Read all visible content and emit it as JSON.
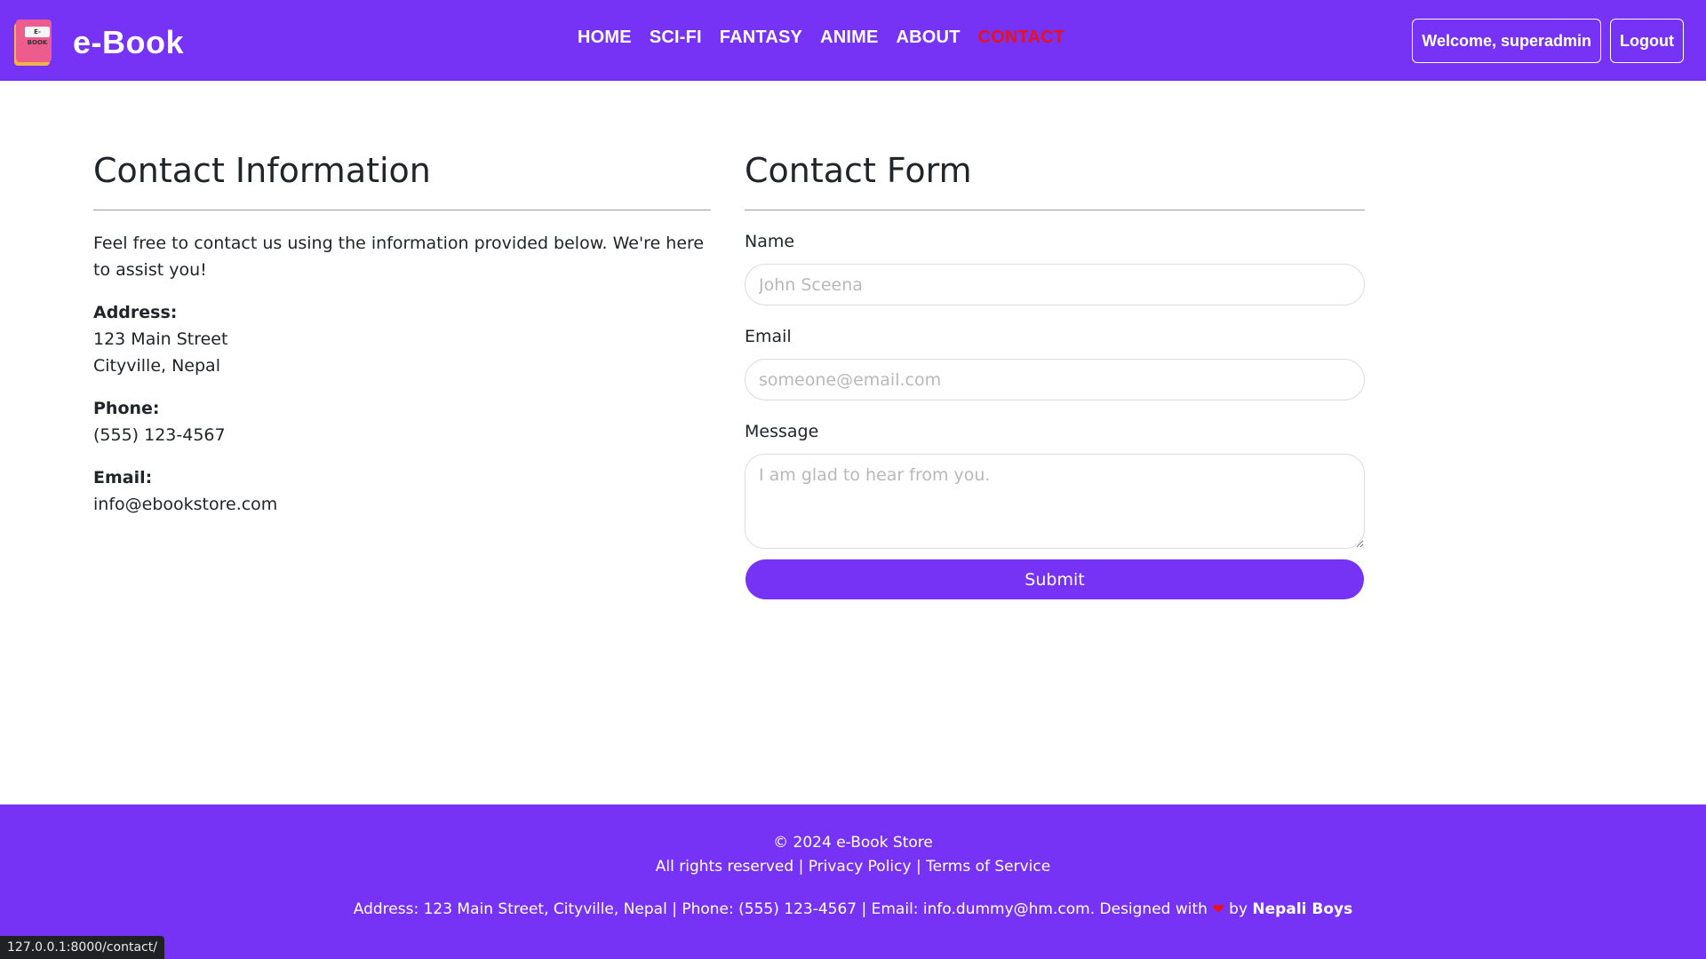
{
  "brand": {
    "logo_label": "E-BOOK",
    "name": "e-Book"
  },
  "nav": {
    "items": [
      {
        "label": "HOME"
      },
      {
        "label": "SCI-FI"
      },
      {
        "label": "FANTASY"
      },
      {
        "label": "ANIME"
      },
      {
        "label": "ABOUT"
      },
      {
        "label": "CONTACT"
      }
    ],
    "active": "CONTACT",
    "welcome_label": "Welcome, superadmin",
    "logout_label": "Logout"
  },
  "contact_info": {
    "title": "Contact Information",
    "intro": "Feel free to contact us using the information provided below. We're here to assist you!",
    "address_label": "Address:",
    "address_line1": "123 Main Street",
    "address_line2": "Cityville, Nepal",
    "phone_label": "Phone:",
    "phone": "(555) 123-4567",
    "email_label": "Email:",
    "email": "info@ebookstore.com"
  },
  "contact_form": {
    "title": "Contact Form",
    "name_label": "Name",
    "name_placeholder": "John Sceena",
    "email_label": "Email",
    "email_placeholder": "someone@email.com",
    "message_label": "Message",
    "message_placeholder": "I am glad to hear from you.",
    "submit_label": "Submit"
  },
  "footer": {
    "copyright": "© 2024 e-Book Store",
    "rights": "All rights reserved",
    "privacy": "Privacy Policy",
    "terms": "Terms of Service",
    "separator": "|",
    "contact_line": "Address: 123 Main Street, Cityville, Nepal | Phone: (555) 123-4567 | Email: info.dummy@hm.com. Designed with",
    "by": "by",
    "designer": "Nepali Boys"
  },
  "status_url": "127.0.0.1:8000/contact/",
  "colors": {
    "primary": "#7733f5",
    "active_link": "#e8111d"
  }
}
